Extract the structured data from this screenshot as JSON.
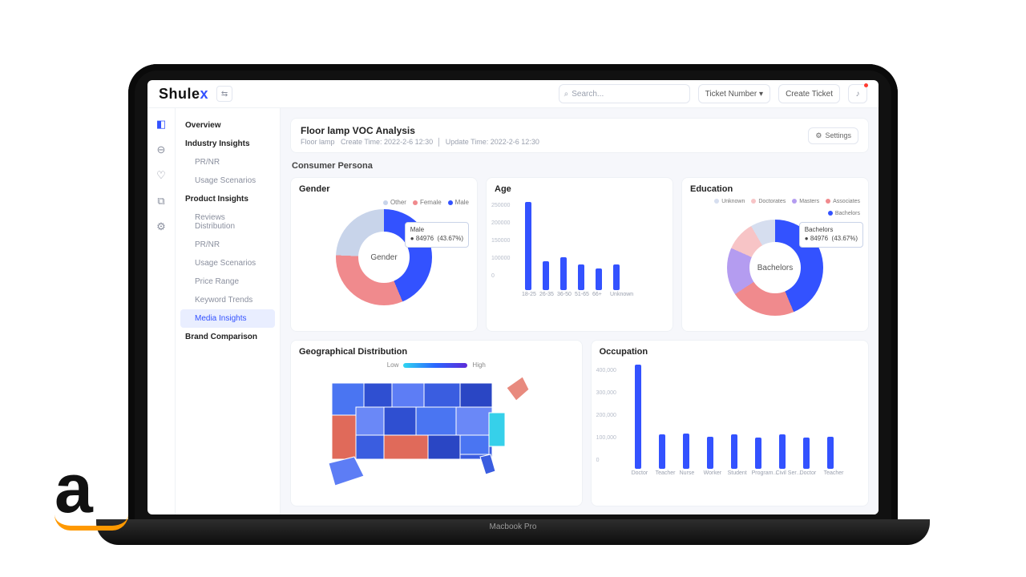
{
  "brand": {
    "name": "Shule",
    "accent": "x"
  },
  "header": {
    "search_placeholder": "Search...",
    "selector": "Ticket Number",
    "create": "Create Ticket"
  },
  "sidebar": {
    "rail": [
      "dashboard",
      "globe",
      "shield",
      "analytics",
      "settings"
    ],
    "overview": "Overview",
    "industry": "Industry Insights",
    "industry_items": [
      "PR/NR",
      "Usage Scenarios"
    ],
    "product": "Product Insights",
    "product_items": [
      "Reviews Distribution",
      "PR/NR",
      "Usage Scenarios",
      "Price Range",
      "Keyword Trends",
      "Media Insights"
    ],
    "brand": "Brand Comparison"
  },
  "titlebar": {
    "title": "Floor lamp VOC Analysis",
    "crumb": "Floor lamp",
    "create": "Create Time: 2022-2-6 12:30",
    "update": "Update Time: 2022-2-6 12:30",
    "settings": "Settings"
  },
  "section": "Consumer Persona",
  "cards": {
    "gender": {
      "title": "Gender",
      "center": "Gender",
      "legend": [
        "Other",
        "Female",
        "Male"
      ],
      "tip_name": "Male",
      "tip_value": "84976",
      "tip_pct": "(43.67%)"
    },
    "age": {
      "title": "Age"
    },
    "education": {
      "title": "Education",
      "center": "Bachelors",
      "legend": [
        "Unknown",
        "Doctorates",
        "Masters",
        "Associates",
        "Bachelors"
      ],
      "tip_name": "Bachelors",
      "tip_value": "84976",
      "tip_pct": "(43.67%)"
    },
    "geo": {
      "title": "Geographical Distribution",
      "low": "Low",
      "high": "High"
    },
    "occ": {
      "title": "Occupation"
    }
  },
  "chart_data": [
    {
      "type": "pie",
      "title": "Gender",
      "series": [
        {
          "name": "Male",
          "value": 43.67,
          "color": "#3352ff"
        },
        {
          "name": "Female",
          "value": 32,
          "color": "#f08a8d"
        },
        {
          "name": "Other",
          "value": 24.33,
          "color": "#c8d4ea"
        }
      ],
      "highlight": {
        "name": "Male",
        "count": 84976,
        "pct": 43.67
      }
    },
    {
      "type": "bar",
      "title": "Age",
      "ylabel": "",
      "ylim": [
        0,
        250000
      ],
      "categories": [
        "18-25",
        "26-35",
        "36-50",
        "51-65",
        "66+",
        "Unknown"
      ],
      "values": [
        240000,
        80000,
        90000,
        70000,
        60000,
        70000
      ],
      "ticks": [
        0,
        100000,
        150000,
        200000,
        250000
      ]
    },
    {
      "type": "pie",
      "title": "Education",
      "series": [
        {
          "name": "Bachelors",
          "value": 43.67,
          "color": "#3352ff"
        },
        {
          "name": "Associates",
          "value": 22,
          "color": "#f08a8d"
        },
        {
          "name": "Masters",
          "value": 16,
          "color": "#b49cf0"
        },
        {
          "name": "Doctorates",
          "value": 10,
          "color": "#f7c4c6"
        },
        {
          "name": "Unknown",
          "value": 8.33,
          "color": "#d6deef"
        }
      ],
      "highlight": {
        "name": "Bachelors",
        "count": 84976,
        "pct": 43.67
      }
    },
    {
      "type": "heatmap",
      "title": "Geographical Distribution",
      "legend": {
        "low": "Low",
        "high": "High"
      },
      "note": "US choropleth — state fills range low→high on a cyan→blue→violet scale; CA/TX/LA shown red (outliers)."
    },
    {
      "type": "bar",
      "title": "Occupation",
      "ylabel": "",
      "ylim": [
        0,
        400000
      ],
      "categories": [
        "Doctor",
        "Teacher",
        "Nurse",
        "Worker",
        "Student",
        "Program…",
        "Civil Ser…",
        "Doctor",
        "Teacher"
      ],
      "values": [
        390000,
        130000,
        135000,
        125000,
        130000,
        120000,
        130000,
        120000,
        125000
      ],
      "ticks": [
        0,
        100000,
        200000,
        300000,
        400000
      ]
    }
  ],
  "colors": {
    "blue": "#3352ff",
    "coral": "#f08a8d",
    "grey": "#c8d4ea",
    "violet": "#b49cf0",
    "pink": "#f7c4c6"
  },
  "device": "Macbook Pro"
}
